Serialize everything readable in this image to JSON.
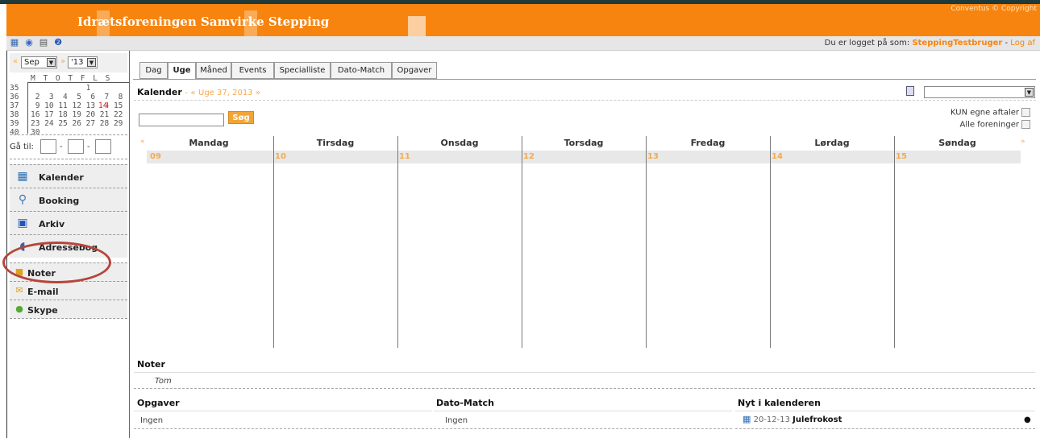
{
  "header": {
    "title": "Idrætsforeningen Samvirke Stepping",
    "copyright": "Conventus © Copyright"
  },
  "toolbar": {
    "icons": [
      "calendar-icon",
      "refresh-icon",
      "print-icon",
      "help-icon"
    ],
    "login_prefix": "Du er logget på som:",
    "user": "SteppingTestbruger",
    "separator": "-",
    "logout": "Log af"
  },
  "minical": {
    "prev": "«",
    "next": "»",
    "month": "Sep",
    "year": "'13",
    "weekdays": "M T O T F L S",
    "weeks": [
      "35",
      "36",
      "37",
      "38",
      "39",
      "40"
    ],
    "rows": [
      "            1",
      " 2  3  4  5  6  7  8",
      " 9 10 11 12 13 14 15",
      "16 17 18 19 20 21 22",
      "23 24 25 26 27 28 29",
      "30"
    ],
    "today": "14",
    "today_color": "#cc2222",
    "goto_label": "Gå til:",
    "goto_sep": "-"
  },
  "menu": [
    {
      "label": "Kalender",
      "icon": "calendar-icon"
    },
    {
      "label": "Booking",
      "icon": "booking-icon"
    },
    {
      "label": "Arkiv",
      "icon": "archive-icon"
    },
    {
      "label": "Adressebog",
      "icon": "addressbook-icon"
    },
    {
      "label": "Noter",
      "icon": "notes-icon"
    },
    {
      "label": "E-mail",
      "icon": "email-icon"
    },
    {
      "label": "Skype",
      "icon": "skype-icon"
    }
  ],
  "tabs": [
    "Dag",
    "Uge",
    "Måned",
    "Events",
    "Specialliste",
    "Dato-Match",
    "Opgaver"
  ],
  "active_tab": "Uge",
  "calendar": {
    "title": "Kalender",
    "title_sep": "-",
    "week_prev": "«",
    "week_label": "Uge 37, 2013",
    "week_next": "»",
    "search_button": "Søg",
    "own_only": "KUN egne aftaler",
    "all_clubs": "Alle foreninger",
    "days": [
      "Mandag",
      "Tirsdag",
      "Onsdag",
      "Torsdag",
      "Fredag",
      "Lørdag",
      "Søndag"
    ],
    "dates": [
      "09",
      "10",
      "11",
      "12",
      "13",
      "14",
      "15"
    ]
  },
  "noter": {
    "title": "Noter",
    "body": "Tom"
  },
  "opgaver": {
    "title": "Opgaver",
    "body": "Ingen"
  },
  "datomatch": {
    "title": "Dato-Match",
    "body": "Ingen"
  },
  "nyt": {
    "title": "Nyt i kalenderen",
    "date": "20-12-13",
    "event": "Julefrokost"
  },
  "colors": {
    "accent": "#f7840f",
    "link": "#f7a94a",
    "highlight_circle": "#b5463c"
  }
}
